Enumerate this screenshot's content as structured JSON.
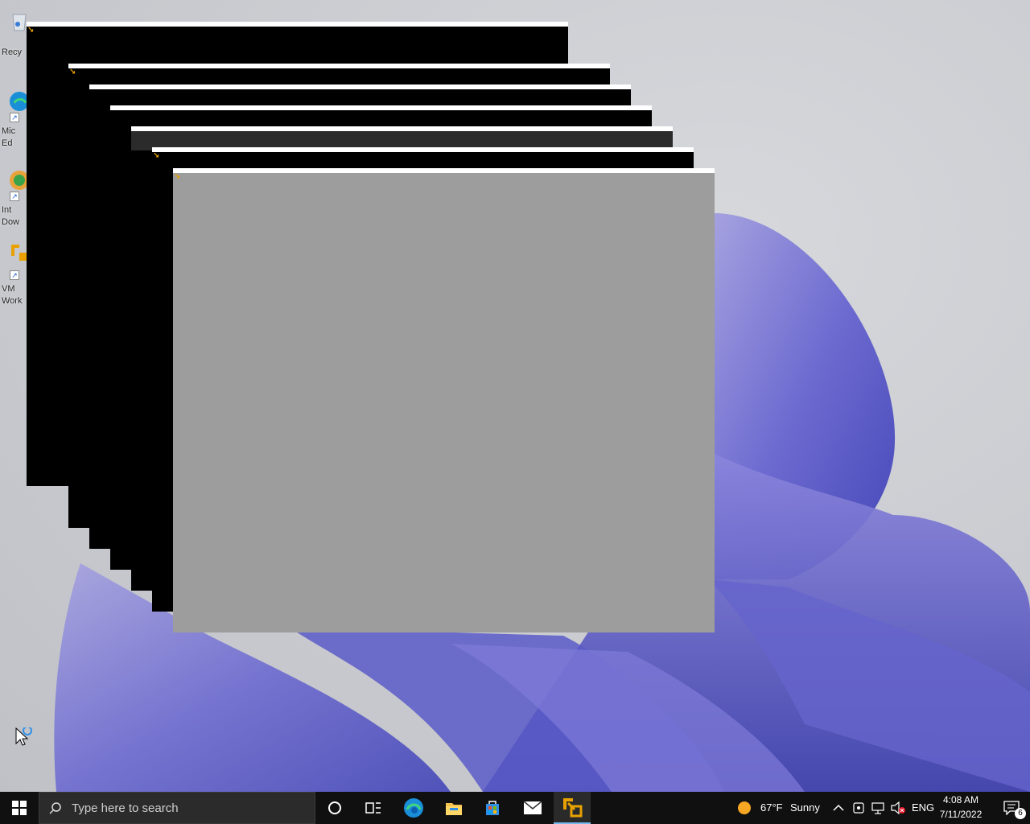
{
  "desktop": {
    "icons": [
      {
        "name": "Recycle Bin",
        "label": "Recy"
      },
      {
        "name": "Microsoft Edge",
        "label": "Mic\nEd"
      },
      {
        "name": "Internet Download Manager",
        "label": "Int\nDow"
      },
      {
        "name": "VMware Workstation",
        "label": "VM\nWork"
      }
    ]
  },
  "windows": {
    "count": 7,
    "app_icon": "vmware-icon",
    "front_fill": "#9d9d9d",
    "back_fill": "#000000"
  },
  "taskbar": {
    "search_placeholder": "Type here to search",
    "pinned": [
      "cortana-icon",
      "task-view-icon",
      "edge-icon",
      "file-explorer-icon",
      "store-icon",
      "mail-icon",
      "vmware-icon"
    ],
    "weather": {
      "temp": "67°F",
      "condition": "Sunny"
    },
    "language": "ENG",
    "clock": {
      "time": "4:08 AM",
      "date": "7/11/2022"
    },
    "notification_count": "6"
  },
  "colors": {
    "accent": "#0078d4",
    "taskbar": "#101010",
    "vmware": "#e8a100"
  }
}
